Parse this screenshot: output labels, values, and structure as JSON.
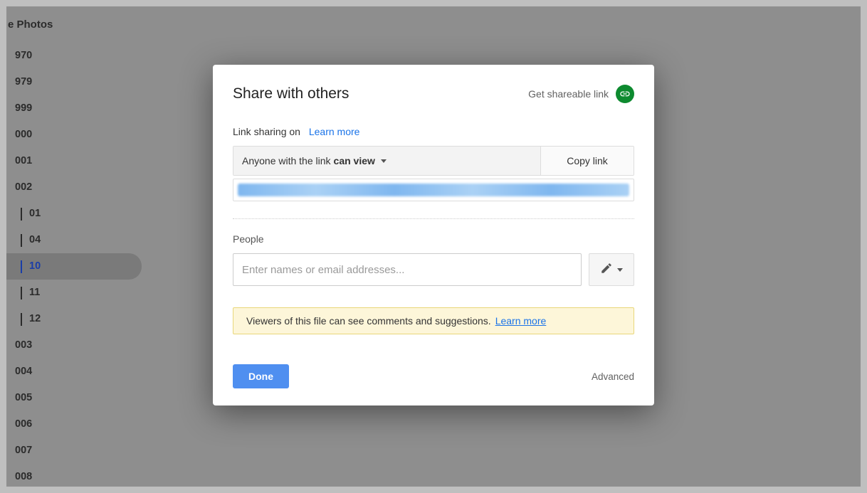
{
  "sidebar": {
    "title": "e Photos",
    "items": [
      {
        "label": "970",
        "sub": false
      },
      {
        "label": "979",
        "sub": false
      },
      {
        "label": "999",
        "sub": false
      },
      {
        "label": "000",
        "sub": false
      },
      {
        "label": "001",
        "sub": false
      },
      {
        "label": "002",
        "sub": false
      },
      {
        "label": "01",
        "sub": true,
        "selected": false
      },
      {
        "label": "04",
        "sub": true,
        "selected": false
      },
      {
        "label": "10",
        "sub": true,
        "selected": true
      },
      {
        "label": "11",
        "sub": true,
        "selected": false
      },
      {
        "label": "12",
        "sub": true,
        "selected": false
      },
      {
        "label": "003",
        "sub": false
      },
      {
        "label": "004",
        "sub": false
      },
      {
        "label": "005",
        "sub": false
      },
      {
        "label": "006",
        "sub": false
      },
      {
        "label": "007",
        "sub": false
      },
      {
        "label": "008",
        "sub": false
      }
    ]
  },
  "modal": {
    "title": "Share with others",
    "get_link": "Get shareable link",
    "link_status": "Link sharing on",
    "learn_more": "Learn more",
    "access_prefix": "Anyone with the link",
    "access_level": "can view",
    "copy": "Copy link",
    "people_label": "People",
    "people_placeholder": "Enter names or email addresses...",
    "notice_text": "Viewers of this file can see comments and suggestions.",
    "notice_link": "Learn more",
    "done": "Done",
    "advanced": "Advanced"
  }
}
